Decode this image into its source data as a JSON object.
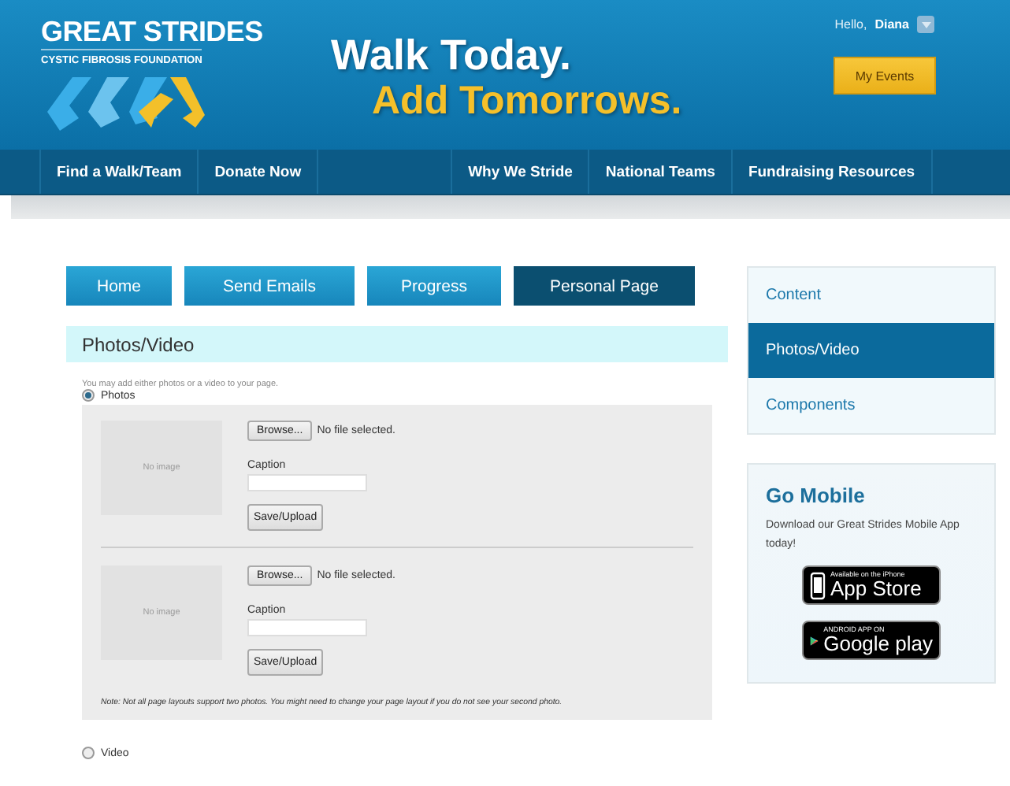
{
  "header": {
    "logo_title": "GREAT STRIDES",
    "logo_subtitle": "CYSTIC FIBROSIS FOUNDATION",
    "tagline_1": "Walk Today.",
    "tagline_2": "Add Tomorrows.",
    "greeting": "Hello,",
    "user_name": "Diana",
    "my_events_button": "My Events"
  },
  "nav_left": [
    {
      "label": "Find a Walk/Team"
    },
    {
      "label": "Donate Now"
    }
  ],
  "nav_right": [
    {
      "label": "Why We Stride"
    },
    {
      "label": "National Teams"
    },
    {
      "label": "Fundraising Resources"
    }
  ],
  "tabs": [
    {
      "label": "Home",
      "selected": false
    },
    {
      "label": "Send Emails",
      "selected": false
    },
    {
      "label": "Progress",
      "selected": false
    },
    {
      "label": "Personal Page",
      "selected": true
    }
  ],
  "section": {
    "title": "Photos/Video",
    "intro": "You may add either photos or a video to your page.",
    "photos_option": {
      "label": "Photos",
      "selected": true
    },
    "photos": [
      {
        "placeholder": "No image",
        "browse_button": "Browse...",
        "file_status": "No file selected.",
        "caption_label": "Caption",
        "save_button": "Save/Upload"
      },
      {
        "placeholder": "No image",
        "browse_button": "Browse...",
        "file_status": "No file selected.",
        "caption_label": "Caption",
        "save_button": "Save/Upload"
      }
    ],
    "note": "Note: Not all page layouts support two photos. You might need to change your page layout if you do not see your second photo.",
    "video_option": {
      "label": "Video",
      "selected": false
    }
  },
  "sidebar": {
    "menu": [
      {
        "label": "Content",
        "selected": false
      },
      {
        "label": "Photos/Video",
        "selected": true
      },
      {
        "label": "Components",
        "selected": false
      }
    ],
    "mobile": {
      "title": "Go Mobile",
      "text": "Download our Great Strides Mobile App today!",
      "badges": [
        {
          "kind": "apple",
          "small": "Available on the iPhone",
          "big": "App Store"
        },
        {
          "kind": "google",
          "small": "ANDROID APP ON",
          "big": "Google play"
        }
      ]
    }
  }
}
